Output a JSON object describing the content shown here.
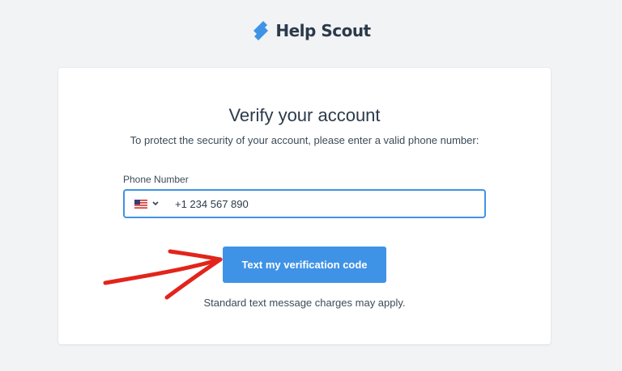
{
  "brand": {
    "name": "Help Scout",
    "color": "#3f93e6"
  },
  "card": {
    "title": "Verify your account",
    "subtitle": "To protect the security of your account, please enter a valid phone number:"
  },
  "phone": {
    "label": "Phone Number",
    "country_icon": "us-flag-icon",
    "value": "+1 234 567 890"
  },
  "button": {
    "label": "Text my verification code"
  },
  "note": "Standard text message charges may apply.",
  "annotation": {
    "type": "red-arrow",
    "color": "#e2241b"
  }
}
